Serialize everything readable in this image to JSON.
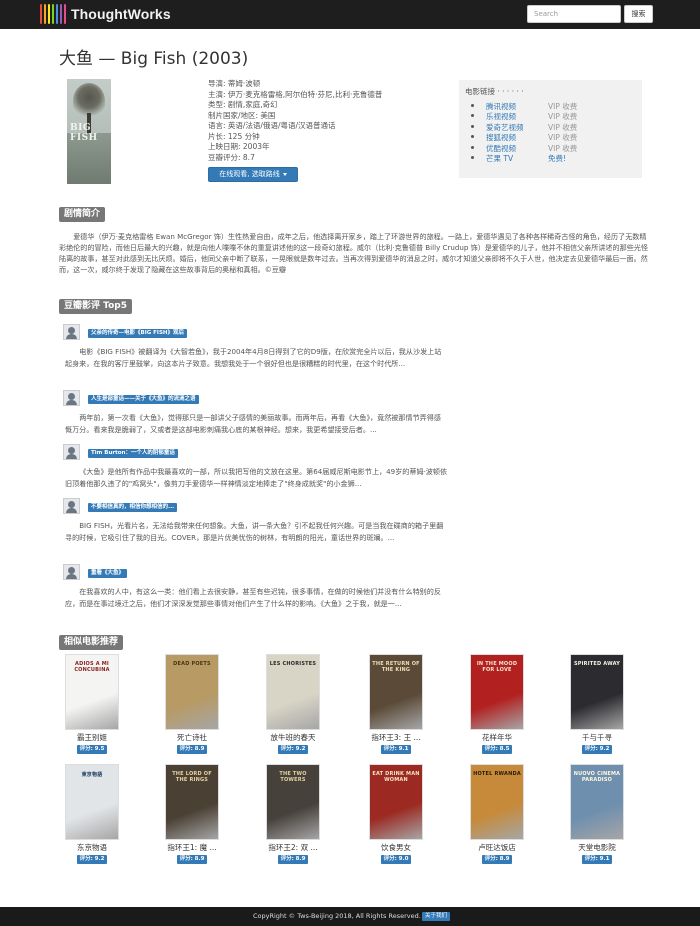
{
  "brand": {
    "name": "ThoughtWorks",
    "colors": [
      "#e94e3d",
      "#f5a623",
      "#f8e71c",
      "#7ed321",
      "#4a90e2",
      "#9b59b6",
      "#e74c8c"
    ]
  },
  "search": {
    "placeholder": "Search",
    "button_label": "搜索"
  },
  "movie": {
    "title": "大鱼 — Big Fish (2003)",
    "poster_text": "BIG FISH",
    "info": [
      "导演: 蒂姆·波顿",
      "主演: 伊万·麦克格雷格,阿尔伯特·芬尼,比利·克鲁德普",
      "类型: 剧情,家庭,奇幻",
      "制片国家/地区: 美国",
      "语言: 英语/法语/俄语/粤语/汉语普通话",
      "片长: 125 分钟",
      "上映日期: 2003年",
      "豆瓣评分: 8.7"
    ],
    "watch_button": "在线观看, 选取路线"
  },
  "links": {
    "title": "电影链接 · · · · · ·",
    "items": [
      {
        "name": "腾讯视频",
        "price": "VIP 收费"
      },
      {
        "name": "乐视视频",
        "price": "VIP 收费"
      },
      {
        "name": "爱奇艺视频",
        "price": "VIP 收费"
      },
      {
        "name": "搜狐视频",
        "price": "VIP 收费"
      },
      {
        "name": "优酷视频",
        "price": "VIP 收费"
      },
      {
        "name": "芒果 TV",
        "price": "免费!"
      }
    ]
  },
  "synopsis": {
    "label": "剧情简介",
    "text": "爱德华（伊万·麦克格雷格 Ewan McGregor 饰）生性热爱自由，成年之后，他选择离开家乡，踏上了环游世界的旅程。一路上，爱德华遇见了各种各样稀奇古怪的角色，经历了无数精彩绝伦的的冒险，而他日后最大的兴趣，就是向他人喋喋不休的重复讲述他的这一段奇幻旅程。威尔（比利·克鲁德普 Billy Crudup 饰）是爱德华的儿子，他并不相信父亲所讲述的那些光怪陆离的故事，甚至对此感到无比厌烦。婚后，他同父亲中断了联系，一晃眼就是数年过去。当再次得到爱德华的消息之时，威尔才知道父亲即将不久于人世，他决定去见爱德华最后一面。然而，这一次，威尔终于发现了隐藏在这些故事背后的奥秘和真相。©豆瓣"
  },
  "reviews": {
    "label": "豆瓣影评 Top5",
    "items": [
      {
        "title": "父亲的传奇—电影《BIG FISH》观后",
        "body": "电影《BIG FISH》被翻译为《大智若鱼》，我于2004年4月8日得到了它的D9版，在欣赏完全片以后，我从沙发上站起身来，在我的客厅里鼓掌，向这本片子致意。我想我处于一个很好但也是很糟糕的时代里，在这个时代所..."
      },
      {
        "title": "人生是部童话——关于《大鱼》的流淌之语",
        "body": "两年前，第一次看《大鱼》，觉得那只是一部讲父子感情的美丽故事。而两年后，再看《大鱼》，竟然被那情节弄得感慨万分。看来我是脆弱了，又或者是这部电影刺痛我心底的某根神经。想来，我更希望接受后者。..."
      },
      {
        "title": "Tim Burton：一个人的阴郁童话",
        "body": "《大鱼》是他所有作品中我最喜欢的一部，所以我把写他的文放在这里。第64届威尼斯电影节上，49岁的蒂姆·波顿依旧顶着他那久违了的\"鸡窝头\"，像剪刀手爱德华一样神情淡定地捧走了\"终身成就奖\"的小金狮..."
      },
      {
        "title": "不要相信真的，相信你想相信的...",
        "body": "BIG FISH，光看片名，无法给我带来任何想象。大鱼，讲一条大鱼？引不起我任何兴趣。可是当我在碟商的箱子里翻寻的时候，它吸引住了我的目光。COVER，那是片优美忧伤的树林，有明朗的阳光，童话世界的斑斓。..."
      },
      {
        "title": "重看《大鱼》",
        "body": "在我喜欢的人中，有这么一类：他们看上去很安静，甚至有些迟钝，很多事情，在做的时候他们并没有什么特别的反应，而是在事过境迁之后，他们才深深发觉那些事情对他们产生了什么样的影响。《大鱼》之于我，就是一..."
      }
    ]
  },
  "similar": {
    "label": "相似电影推荐",
    "items": [
      {
        "name": "霸王别姬",
        "score": "评分: 9.5",
        "bg": "#f4f4f2",
        "fg": "#8a1d1d",
        "cover_text": "ADIOS A MI CONCUBINA"
      },
      {
        "name": "死亡诗社",
        "score": "评分: 8.9",
        "bg": "#b89a64",
        "fg": "#4a3417",
        "cover_text": "DEAD POETS"
      },
      {
        "name": "放牛班的春天",
        "score": "评分: 9.2",
        "bg": "#d8d4c6",
        "fg": "#2d2a24",
        "cover_text": "LES CHORISTES"
      },
      {
        "name": "指环王3: 王 ...",
        "score": "评分: 9.1",
        "bg": "#5a4a37",
        "fg": "#f0dfb5",
        "cover_text": "THE RETURN OF THE KING"
      },
      {
        "name": "花样年华",
        "score": "评分: 8.5",
        "bg": "#b32020",
        "fg": "#f2e3d0",
        "cover_text": "IN THE MOOD FOR LOVE"
      },
      {
        "name": "千与千寻",
        "score": "评分: 9.2",
        "bg": "#2b2b30",
        "fg": "#f6f2e8",
        "cover_text": "SPIRITED AWAY"
      },
      {
        "name": "东京物语",
        "score": "评分: 9.2",
        "bg": "#e2e5e8",
        "fg": "#1c3b64",
        "cover_text": "東京物語"
      },
      {
        "name": "指环王1: 魔 ...",
        "score": "评分: 8.9",
        "bg": "#4a4034",
        "fg": "#e8d4a0",
        "cover_text": "THE LORD OF THE RINGS"
      },
      {
        "name": "指环王2: 双 ...",
        "score": "评分: 8.9",
        "bg": "#46413b",
        "fg": "#e4d2a4",
        "cover_text": "THE TWO TOWERS"
      },
      {
        "name": "饮食男女",
        "score": "评分: 9.0",
        "bg": "#9c2a22",
        "fg": "#f3e4c7",
        "cover_text": "EAT DRINK MAN WOMAN"
      },
      {
        "name": "卢旺达饭店",
        "score": "评分: 8.9",
        "bg": "#c68a3a",
        "fg": "#2a1d0c",
        "cover_text": "HOTEL RWANDA"
      },
      {
        "name": "天堂电影院",
        "score": "评分: 9.1",
        "bg": "#6f8fae",
        "fg": "#fff7e2",
        "cover_text": "NUOVO CINEMA PARADISO"
      }
    ]
  },
  "footer": {
    "copyright": "CopyRight © Tws-Beijing 2018, All Rights Reserved.",
    "about_label": "关于我们"
  }
}
